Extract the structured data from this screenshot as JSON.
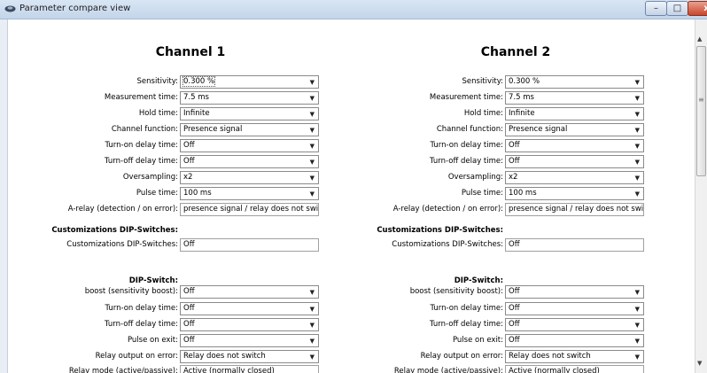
{
  "window": {
    "title": "Parameter compare view",
    "min_label": "–",
    "max_label": "□",
    "close_label": "x"
  },
  "scrollbar": {
    "up": "▲",
    "down": "▼",
    "grip": "≡"
  },
  "channels": [
    {
      "title": "Channel 1",
      "rows": [
        {
          "label": "Sensitivity:",
          "value": "0.300 %",
          "type": "dropdown"
        },
        {
          "label": "Measurement time:",
          "value": "7.5 ms",
          "type": "dropdown"
        },
        {
          "label": "Hold time:",
          "value": "Infinite",
          "type": "dropdown"
        },
        {
          "label": "Channel function:",
          "value": "Presence signal",
          "type": "dropdown"
        },
        {
          "label": "Turn-on delay time:",
          "value": "Off",
          "type": "dropdown"
        },
        {
          "label": "Turn-off delay time:",
          "value": "Off",
          "type": "dropdown"
        },
        {
          "label": "Oversampling:",
          "value": "x2",
          "type": "dropdown"
        },
        {
          "label": "Pulse time:",
          "value": "100 ms",
          "type": "dropdown"
        },
        {
          "label": "A-relay (detection / on error):",
          "value": "presence signal / relay does not switch",
          "type": "textbox"
        },
        {
          "label": "Customizations DIP-Switches:",
          "value": "",
          "type": "header"
        },
        {
          "label": "Customizations DIP-Switches:",
          "value": "Off",
          "type": "textbox"
        },
        {
          "label": "DIP-Switch:",
          "value": "",
          "type": "header"
        },
        {
          "label": "boost (sensitivity boost):",
          "value": "Off",
          "type": "dropdown"
        },
        {
          "label": "Turn-on delay time:",
          "value": "Off",
          "type": "dropdown"
        },
        {
          "label": "Turn-off delay time:",
          "value": "Off",
          "type": "dropdown"
        },
        {
          "label": "Pulse on exit:",
          "value": "Off",
          "type": "dropdown"
        },
        {
          "label": "Relay output on error:",
          "value": "Relay does not switch",
          "type": "dropdown"
        },
        {
          "label": "Relay mode (active/passive):",
          "value": "Active (normally closed)",
          "type": "textbox"
        }
      ]
    },
    {
      "title": "Channel 2",
      "rows": [
        {
          "label": "Sensitivity:",
          "value": "0.300 %",
          "type": "dropdown"
        },
        {
          "label": "Measurement time:",
          "value": "7.5 ms",
          "type": "dropdown"
        },
        {
          "label": "Hold time:",
          "value": "Infinite",
          "type": "dropdown"
        },
        {
          "label": "Channel function:",
          "value": "Presence signal",
          "type": "dropdown"
        },
        {
          "label": "Turn-on delay time:",
          "value": "Off",
          "type": "dropdown"
        },
        {
          "label": "Turn-off delay time:",
          "value": "Off",
          "type": "dropdown"
        },
        {
          "label": "Oversampling:",
          "value": "x2",
          "type": "dropdown"
        },
        {
          "label": "Pulse time:",
          "value": "100 ms",
          "type": "dropdown"
        },
        {
          "label": "A-relay (detection / on error):",
          "value": "presence signal / relay does not switch",
          "type": "textbox"
        },
        {
          "label": "Customizations DIP-Switches:",
          "value": "",
          "type": "header"
        },
        {
          "label": "Customizations DIP-Switches:",
          "value": "Off",
          "type": "textbox"
        },
        {
          "label": "DIP-Switch:",
          "value": "",
          "type": "header"
        },
        {
          "label": "boost (sensitivity boost):",
          "value": "Off",
          "type": "dropdown"
        },
        {
          "label": "Turn-on delay time:",
          "value": "Off",
          "type": "dropdown"
        },
        {
          "label": "Turn-off delay time:",
          "value": "Off",
          "type": "dropdown"
        },
        {
          "label": "Pulse on exit:",
          "value": "Off",
          "type": "dropdown"
        },
        {
          "label": "Relay output on error:",
          "value": "Relay does not switch",
          "type": "dropdown"
        },
        {
          "label": "Relay mode (active/passive):",
          "value": "Active (normally closed)",
          "type": "textbox"
        }
      ]
    }
  ],
  "icons": {
    "dropdown": "chevron-down-icon",
    "app": "app-icon"
  },
  "colors": {
    "titlebar": "#c9d9ee",
    "close": "#c9462c"
  }
}
